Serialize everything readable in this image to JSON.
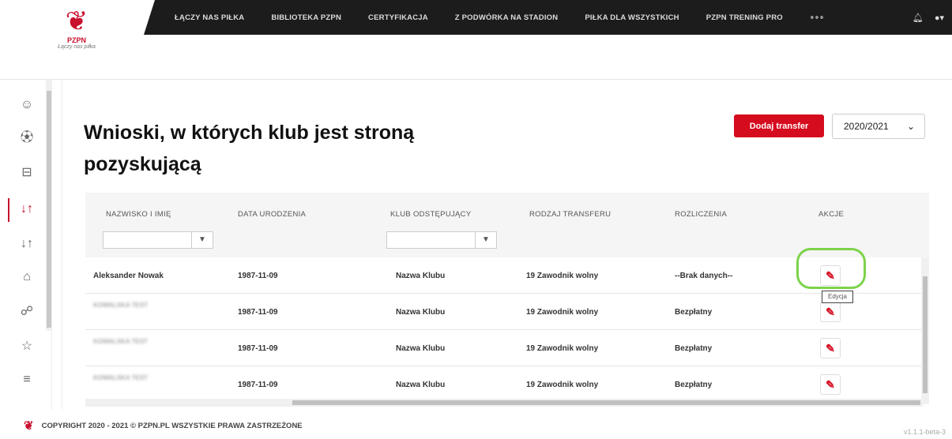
{
  "brand": {
    "name": "PZPN",
    "tagline": "Łączy nas piłka"
  },
  "nav": {
    "items": [
      "ŁĄCZY NAS PIŁKA",
      "BIBLIOTEKA PZPN",
      "CERTYFIKACJA",
      "Z PODWÓRKA NA STADION",
      "PIŁKA DLA WSZYSTKICH",
      "PZPN TRENING PRO"
    ],
    "more": "∘∘∘"
  },
  "sidebar": {
    "icons": [
      "user-icon",
      "ball-icon",
      "cup-icon",
      "transfer-icon",
      "transfer-icon",
      "shirt-icon",
      "people-icon",
      "star-icon",
      "menu-icon"
    ]
  },
  "page": {
    "title": "Wnioski, w których klub jest stroną pozyskującą",
    "add_button": "Dodaj transfer",
    "season": "2020/2021"
  },
  "table": {
    "columns": [
      "NAZWISKO I IMIĘ",
      "DATA URODZENIA",
      "KLUB ODSTĘPUJĄCY",
      "RODZAJ TRANSFERU",
      "ROZLICZENIA",
      "AKCJE"
    ],
    "rows": [
      {
        "name": "Aleksander Nowak",
        "dob": "1987-11-09",
        "club": "Nazwa Klubu",
        "type": "19  Zawodnik wolny",
        "settle": "--Brak danych--"
      },
      {
        "name": "KOWALSKA TEST",
        "dob": "1987-11-09",
        "club": "Nazwa Klubu",
        "type": "19  Zawodnik wolny",
        "settle": "Bezpłatny"
      },
      {
        "name": "KOWALSKA TEST",
        "dob": "1987-11-09",
        "club": "Nazwa Klubu",
        "type": "19  Zawodnik wolny",
        "settle": "Bezpłatny"
      },
      {
        "name": "KOWALSKA TEST",
        "dob": "1987-11-09",
        "club": "Nazwa Klubu",
        "type": "19  Zawodnik wolny",
        "settle": "Bezpłatny"
      }
    ],
    "tooltip": "Edycja"
  },
  "footer": {
    "copyright": "COPYRIGHT 2020 - 2021 © PZPN.PL WSZYSTKIE PRAWA ZASTRZEŻONE",
    "version": "v1.1.1-beta-3"
  },
  "colors": {
    "accent": "#d50b1e",
    "highlight": "#7dd34b",
    "nav_bg": "#1c1c1c"
  }
}
